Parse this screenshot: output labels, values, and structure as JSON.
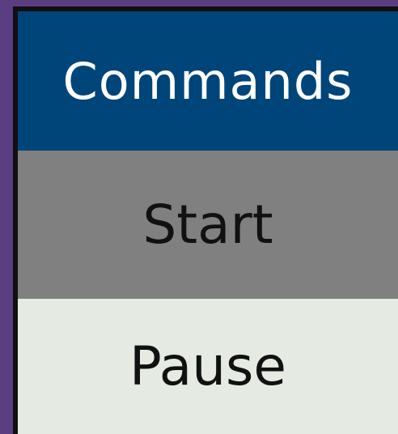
{
  "header": {
    "title": "Commands"
  },
  "commands": [
    {
      "label": "Start"
    },
    {
      "label": "Pause"
    }
  ],
  "colors": {
    "background": "#5b3d82",
    "header": "#00457a",
    "start_row": "#808080",
    "pause_row": "#e5ebe2"
  }
}
